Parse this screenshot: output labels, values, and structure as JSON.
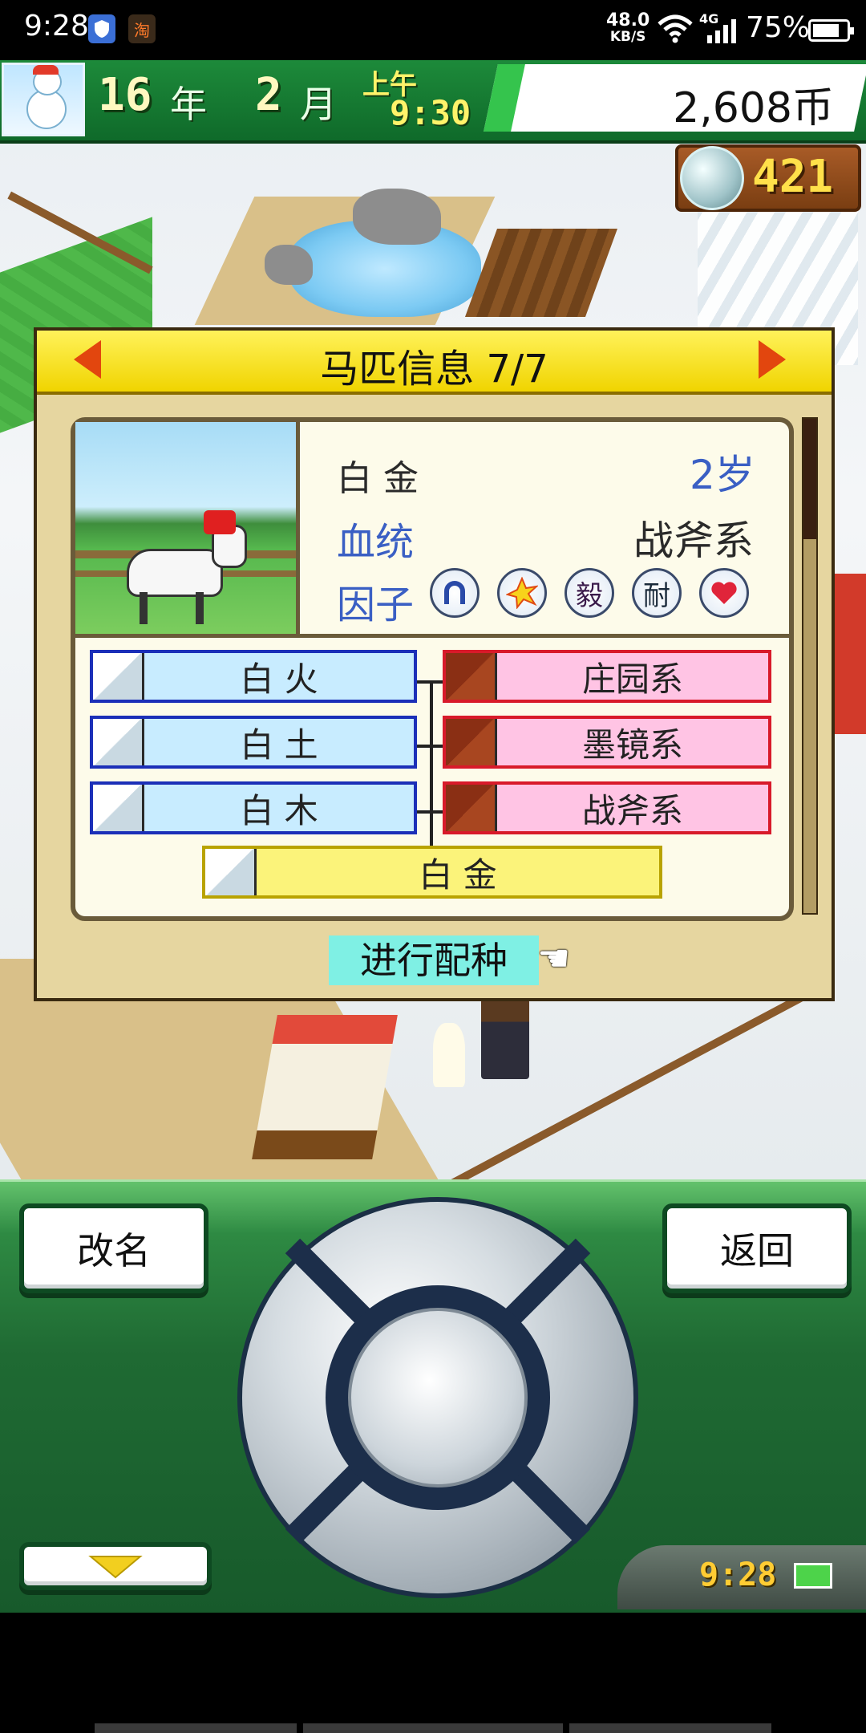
{
  "status_bar": {
    "time": "9:28",
    "network_speed_value": "48.0",
    "network_speed_unit": "KB/S",
    "network_type": "4G",
    "battery_percent": "75%",
    "notif_icons": [
      "shield-icon",
      "taobao-icon"
    ],
    "taobao_glyph": "淘"
  },
  "hud": {
    "year_value": "16",
    "year_unit": "年",
    "month_value": "2",
    "month_unit": "月",
    "period": "上午",
    "clock": "9:30",
    "money": "2,608币",
    "medals": "421"
  },
  "dialog": {
    "title": "马匹信息 7/7",
    "horse_name": "白 金",
    "age": "2岁",
    "bloodline_label": "血统",
    "bloodline_value": "战斧系",
    "factor_label": "因子",
    "factors": [
      "horseshoe",
      "burst",
      "毅",
      "耐",
      "heart"
    ],
    "pedigree": {
      "sire_side": [
        "白 火",
        "白 土",
        "白 木"
      ],
      "dam_side": [
        "庄园系",
        "墨镜系",
        "战斧系"
      ],
      "self": "白 金"
    },
    "breed_button": "进行配种"
  },
  "controls": {
    "rename_button": "改名",
    "back_button": "返回",
    "game_clock": "9:28"
  },
  "colors": {
    "accent_green": "#1d8a3a",
    "title_yellow": "#f0d400",
    "sire_blue": "#1b2fb8",
    "dam_red": "#d81a2a",
    "breed_cyan": "#7ff0e4"
  }
}
